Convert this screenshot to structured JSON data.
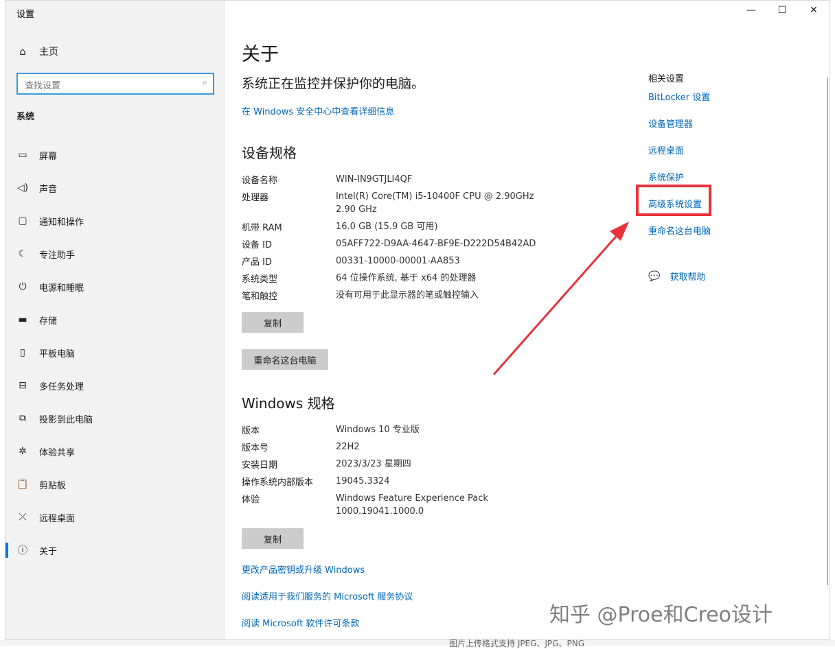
{
  "window": {
    "title": "设置",
    "minimize_icon": "—",
    "maximize_icon": "☐",
    "close_icon": "✕"
  },
  "sidebar": {
    "home_label": "主页",
    "search_placeholder": "查找设置",
    "section_label": "系统",
    "items": [
      {
        "label": "屏幕",
        "icon": "display-icon"
      },
      {
        "label": "声音",
        "icon": "sound-icon"
      },
      {
        "label": "通知和操作",
        "icon": "notification-icon"
      },
      {
        "label": "专注助手",
        "icon": "moon-icon"
      },
      {
        "label": "电源和睡眠",
        "icon": "power-icon"
      },
      {
        "label": "存储",
        "icon": "storage-icon"
      },
      {
        "label": "平板电脑",
        "icon": "tablet-icon"
      },
      {
        "label": "多任务处理",
        "icon": "multitask-icon"
      },
      {
        "label": "投影到此电脑",
        "icon": "project-icon"
      },
      {
        "label": "体验共享",
        "icon": "share-icon"
      },
      {
        "label": "剪贴板",
        "icon": "clipboard-icon"
      },
      {
        "label": "远程桌面",
        "icon": "remote-icon"
      },
      {
        "label": "关于",
        "icon": "info-icon"
      }
    ]
  },
  "main": {
    "title": "关于",
    "status": "系统正在监控并保护你的电脑。",
    "security_link": "在 Windows 安全中心中查看详细信息",
    "device_heading": "设备规格",
    "device_specs": [
      {
        "key": "设备名称",
        "value": "WIN-IN9GTJLI4QF"
      },
      {
        "key": "处理器",
        "value": "Intel(R) Core(TM) i5-10400F CPU @ 2.90GHz   2.90 GHz"
      },
      {
        "key": "机带 RAM",
        "value": "16.0 GB (15.9 GB 可用)"
      },
      {
        "key": "设备 ID",
        "value": "05AFF722-D9AA-4647-BF9E-D222D54B42AD"
      },
      {
        "key": "产品 ID",
        "value": "00331-10000-00001-AA853"
      },
      {
        "key": "系统类型",
        "value": "64 位操作系统, 基于 x64 的处理器"
      },
      {
        "key": "笔和触控",
        "value": "没有可用于此显示器的笔或触控输入"
      }
    ],
    "copy_label": "复制",
    "rename_label": "重命名这台电脑",
    "windows_heading": "Windows 规格",
    "windows_specs": [
      {
        "key": "版本",
        "value": "Windows 10 专业版"
      },
      {
        "key": "版本号",
        "value": "22H2"
      },
      {
        "key": "安装日期",
        "value": "2023/3/23 星期四"
      },
      {
        "key": "操作系统内部版本",
        "value": "19045.3324"
      },
      {
        "key": "体验",
        "value": "Windows Feature Experience Pack 1000.19041.1000.0"
      }
    ],
    "copy2_label": "复制",
    "links": [
      "更改产品密钥或升级 Windows",
      "阅读适用于我们服务的 Microsoft 服务协议",
      "阅读 Microsoft 软件许可条款"
    ]
  },
  "related": {
    "title": "相关设置",
    "links": [
      "BitLocker 设置",
      "设备管理器",
      "远程桌面",
      "系统保护",
      "高级系统设置",
      "重命名这台电脑"
    ],
    "help_label": "获取帮助"
  },
  "watermark": "知乎 @Proe和Creo设计",
  "bottom_partial_text": "图片上传格式支持 JPEG、JPG、PNG",
  "colors": {
    "accent": "#0067b8",
    "highlight": "#e8323c",
    "sidebar_bg": "#f2f2f2"
  }
}
